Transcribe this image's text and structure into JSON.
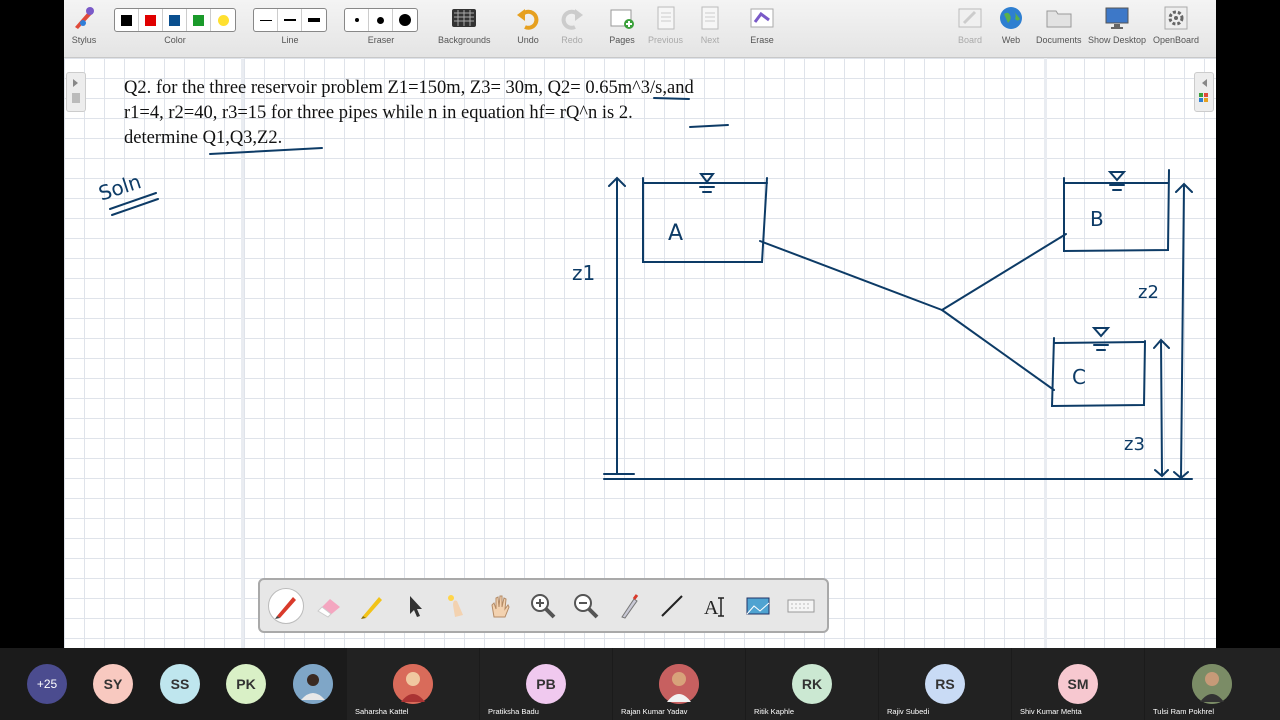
{
  "toolbar": {
    "stylus": "Stylus",
    "color": "Color",
    "line": "Line",
    "eraser": "Eraser",
    "backgrounds": "Backgrounds",
    "undo": "Undo",
    "redo": "Redo",
    "pages": "Pages",
    "previous": "Previous",
    "next": "Next",
    "erase": "Erase",
    "board": "Board",
    "web": "Web",
    "documents": "Documents",
    "show_desktop": "Show Desktop",
    "openboard": "OpenBoard",
    "swatches": [
      "#000000",
      "#e00000",
      "#0a4f8f",
      "#1a9a2a",
      "#ffe030"
    ]
  },
  "board": {
    "question_line1": "Q2. for the three reservoir problem Z1=150m, Z3= 30m, Q2= 0.65m^3/s,and",
    "question_line2": "r1=4, r2=40, r3=15 for three pipes while n in equation hf= rQ^n is 2.",
    "question_line3": "determine Q1,Q3,Z2.",
    "ink_color": "#0d3b66",
    "handwritten": {
      "soln": "Soln",
      "reservoir_a": "A",
      "reservoir_b": "B",
      "reservoir_c": "C",
      "z1": "z1",
      "z2": "z2",
      "z3": "z3"
    }
  },
  "palette": {
    "tools": [
      "pen-icon",
      "eraser-icon",
      "highlighter-icon",
      "pointer-icon",
      "laser-icon",
      "hand-icon",
      "zoom-in-icon",
      "zoom-out-icon",
      "capture-icon",
      "line-icon",
      "text-icon",
      "screenshot-icon",
      "keyboard-icon"
    ]
  },
  "participants": {
    "more_count": "+25",
    "avatars": [
      {
        "initials": "SY",
        "color": "#f8c9c0"
      },
      {
        "initials": "SS",
        "color": "#bfe6ee"
      },
      {
        "initials": "PK",
        "color": "#d9f0c6"
      }
    ],
    "tiles": [
      {
        "name": "Saharsha Kattel",
        "initials": ""
      },
      {
        "name": "Pratiksha Badu",
        "initials": "PB",
        "color": "#f0c9ef"
      },
      {
        "name": "Rajan Kumar Yadav",
        "initials": ""
      },
      {
        "name": "Ritik Kaphle",
        "initials": "RK",
        "color": "#cbe8d2"
      },
      {
        "name": "Rajiv Subedi",
        "initials": "RS",
        "color": "#c9dbf5"
      },
      {
        "name": "Shiv Kumar Mehta",
        "initials": "SM",
        "color": "#f7c8d0"
      },
      {
        "name": "Tulsi Ram Pokhrel",
        "initials": ""
      }
    ]
  }
}
